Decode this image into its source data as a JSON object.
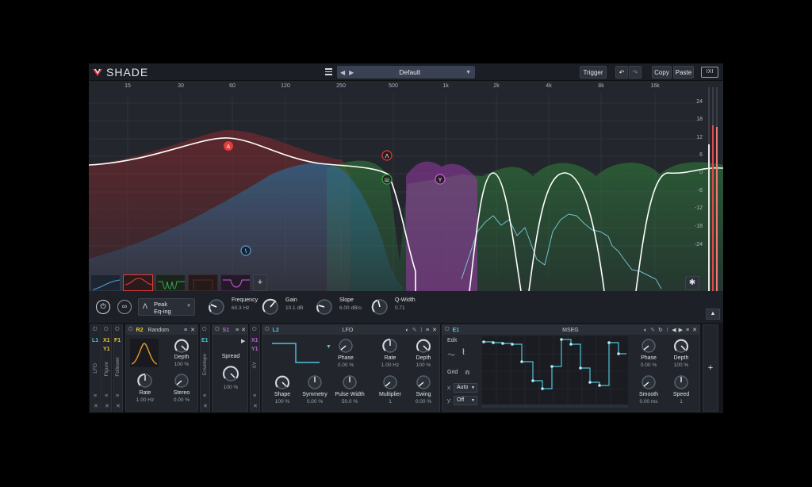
{
  "app": {
    "name": "SHADE"
  },
  "topbar": {
    "preset_name": "Default",
    "trigger_label": "Trigger",
    "copy_label": "Copy",
    "paste_label": "Paste",
    "brand_badge": "IXI"
  },
  "freq_axis": [
    "15",
    "30",
    "60",
    "120",
    "250",
    "500",
    "1k",
    "2k",
    "4k",
    "8k",
    "16k"
  ],
  "gain_axis": [
    "24",
    "18",
    "12",
    "6",
    "0",
    "-6",
    "-12",
    "-18",
    "-24"
  ],
  "band_markers": [
    "A",
    "Λ",
    "Ш",
    "Y",
    "\\"
  ],
  "band_params": {
    "type": "Peak",
    "mode": "Eq-ing",
    "frequency_label": "Frequency",
    "frequency_value": "60.3 Hz",
    "gain_label": "Gain",
    "gain_value": "10.1 dB",
    "slope_label": "Slope",
    "slope_value": "6.00 dB/o",
    "qwidth_label": "Q-Width",
    "qwidth_value": "0.71"
  },
  "mod_tabs": {
    "lfo": {
      "id": "L1",
      "name": "LFO"
    },
    "figure": {
      "ids": [
        "X1",
        "Y1"
      ],
      "name": "Figure"
    },
    "follower": {
      "id": "F1",
      "name": "Follower"
    },
    "envelope": {
      "id": "E1",
      "name": "Envelope"
    },
    "xy": {
      "ids": [
        "X1",
        "Y1"
      ],
      "name": "XY"
    }
  },
  "random_panel": {
    "id": "R2",
    "title": "Random",
    "depth_label": "Depth",
    "depth_value": "100 %",
    "rate_label": "Rate",
    "rate_value": "1.00 Hz",
    "stereo_label": "Stereo",
    "stereo_value": "0.00 %"
  },
  "spread_panel": {
    "id": "S1",
    "spread_label": "Spread",
    "spread_value": "100 %"
  },
  "lfo_panel": {
    "id": "L2",
    "title": "LFO",
    "phase_label": "Phase",
    "phase_value": "0.00 %",
    "rate_label": "Rate",
    "rate_value": "1.00 Hz",
    "depth_label": "Depth",
    "depth_value": "100 %",
    "shape_label": "Shape",
    "shape_value": "100 %",
    "symmetry_label": "Symmetry",
    "symmetry_value": "0.00 %",
    "pulse_label": "Pulse Width",
    "pulse_value": "50.0 %",
    "multiplier_label": "Multiplier",
    "multiplier_value": "1",
    "swing_label": "Swing",
    "swing_value": "0.00 %"
  },
  "mseg_panel": {
    "id": "E1",
    "title": "MSEG",
    "edit_label": "Edit",
    "grid_label": "Grid",
    "x_label": "x:",
    "x_value": "Auto",
    "y_label": "y:",
    "y_value": "Off",
    "phase_label": "Phase",
    "phase_value": "0.00 %",
    "depth_label": "Depth",
    "depth_value": "100 %",
    "smooth_label": "Smooth",
    "smooth_value": "0.00 ms",
    "speed_label": "Speed",
    "speed_value": "1"
  },
  "add_label": "+",
  "colors": {
    "accent_cyan": "#4fc4da",
    "accent_yellow": "#e8c53a",
    "accent_pink": "#c65ed8",
    "accent_red": "#e23b3b",
    "curve_white": "#ffffff"
  }
}
